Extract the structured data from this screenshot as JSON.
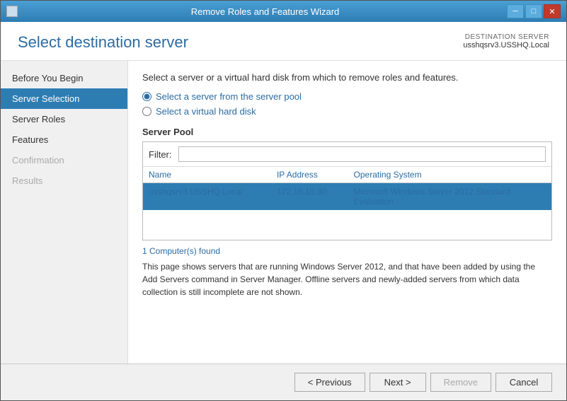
{
  "window": {
    "title": "Remove Roles and Features Wizard",
    "controls": {
      "minimize": "─",
      "maximize": "□",
      "close": "✕"
    }
  },
  "header": {
    "title": "Select destination server",
    "destination_label": "DESTINATION SERVER",
    "destination_server": "usshqsrv3.USSHQ.Local"
  },
  "sidebar": {
    "items": [
      {
        "label": "Before You Begin",
        "state": "normal"
      },
      {
        "label": "Server Selection",
        "state": "active"
      },
      {
        "label": "Server Roles",
        "state": "normal"
      },
      {
        "label": "Features",
        "state": "normal"
      },
      {
        "label": "Confirmation",
        "state": "disabled"
      },
      {
        "label": "Results",
        "state": "disabled"
      }
    ]
  },
  "content": {
    "instruction": "Select a server or a virtual hard disk from which to remove roles and features.",
    "radio_options": [
      {
        "id": "r1",
        "label": "Select a server from the server pool",
        "checked": true
      },
      {
        "id": "r2",
        "label": "Select a virtual hard disk",
        "checked": false
      }
    ],
    "server_pool": {
      "title": "Server Pool",
      "filter_label": "Filter:",
      "filter_placeholder": "",
      "columns": [
        "Name",
        "IP Address",
        "Operating System"
      ],
      "rows": [
        {
          "name": "usshqsrv3.USSHQ.Local",
          "ip": "172.16.10.30",
          "os": "Microsoft Windows Server 2012 Standard Evaluation",
          "selected": true
        }
      ]
    },
    "computers_found": "1 Computer(s) found",
    "note": "This page shows servers that are running Windows Server 2012, and that have been added by using the Add Servers command in Server Manager. Offline servers and newly-added servers from which data collection is still incomplete are not shown."
  },
  "footer": {
    "previous_label": "< Previous",
    "next_label": "Next >",
    "remove_label": "Remove",
    "cancel_label": "Cancel"
  }
}
